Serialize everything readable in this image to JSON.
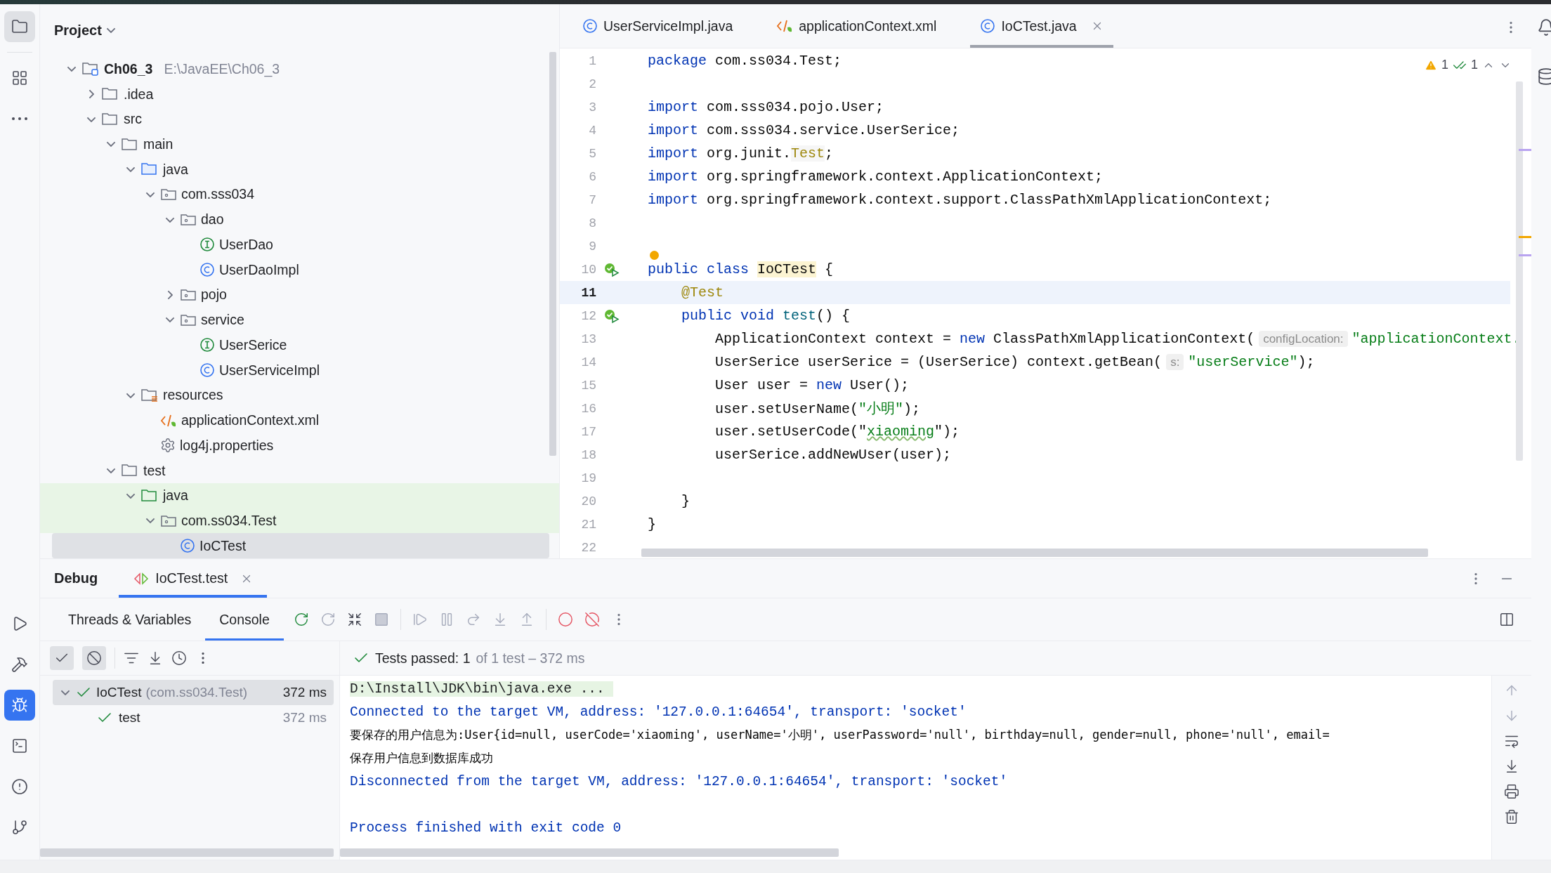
{
  "project": {
    "title": "Project",
    "tree": [
      {
        "name": "Ch06_3",
        "path": "E:\\JavaEE\\Ch06_3",
        "kind": "module",
        "expanded": true,
        "selected": false,
        "children": [
          {
            "name": ".idea",
            "kind": "folder",
            "expanded": false,
            "selected": false
          },
          {
            "name": "src",
            "kind": "folder",
            "expanded": true,
            "selected": false,
            "children": [
              {
                "name": "main",
                "kind": "folder",
                "expanded": true,
                "selected": false,
                "children": [
                  {
                    "name": "java",
                    "kind": "source_root",
                    "expanded": true,
                    "selected": false,
                    "children": [
                      {
                        "name": "com.sss034",
                        "kind": "package",
                        "expanded": true,
                        "selected": false,
                        "children": [
                          {
                            "name": "dao",
                            "kind": "package",
                            "expanded": true,
                            "selected": false,
                            "children": [
                              {
                                "name": "UserDao",
                                "kind": "interface",
                                "selected": false
                              },
                              {
                                "name": "UserDaoImpl",
                                "kind": "class",
                                "selected": false
                              }
                            ]
                          },
                          {
                            "name": "pojo",
                            "kind": "package",
                            "expanded": false,
                            "selected": false
                          },
                          {
                            "name": "service",
                            "kind": "package",
                            "expanded": true,
                            "selected": false,
                            "children": [
                              {
                                "name": "UserSerice",
                                "kind": "interface",
                                "selected": false
                              },
                              {
                                "name": "UserServiceImpl",
                                "kind": "class",
                                "selected": false
                              }
                            ]
                          }
                        ]
                      }
                    ]
                  },
                  {
                    "name": "resources",
                    "kind": "resources_root",
                    "expanded": true,
                    "selected": false,
                    "children": [
                      {
                        "name": "applicationContext.xml",
                        "kind": "xml",
                        "selected": false
                      },
                      {
                        "name": "log4j.properties",
                        "kind": "properties",
                        "selected": false
                      }
                    ]
                  }
                ]
              },
              {
                "name": "test",
                "kind": "folder",
                "expanded": true,
                "selected": false,
                "children": [
                  {
                    "name": "java",
                    "kind": "test_root",
                    "expanded": true,
                    "selected": false,
                    "children": [
                      {
                        "name": "com.ss034.Test",
                        "kind": "package",
                        "expanded": true,
                        "selected": false,
                        "children": [
                          {
                            "name": "IoCTest",
                            "kind": "class",
                            "selected": true
                          }
                        ]
                      }
                    ]
                  }
                ]
              }
            ]
          }
        ]
      }
    ]
  },
  "editor": {
    "tabs": [
      {
        "label": "UserServiceImpl.java",
        "kind": "class",
        "selected": false
      },
      {
        "label": "applicationContext.xml",
        "kind": "xml",
        "selected": false
      },
      {
        "label": "IoCTest.java",
        "kind": "class",
        "selected": true
      }
    ],
    "inspections": {
      "warnings": "1",
      "passed": "1"
    },
    "lines": [
      {
        "number": "1",
        "current": false,
        "tokens": [
          {
            "text": "package ",
            "kind": "keyword"
          },
          {
            "text": "com.ss034.Test;",
            "kind": "plain"
          }
        ]
      },
      {
        "number": "2",
        "current": false
      },
      {
        "number": "3",
        "current": false,
        "tokens": [
          {
            "text": "import ",
            "kind": "keyword"
          },
          {
            "text": "com.sss034.pojo.User;",
            "kind": "plain"
          }
        ]
      },
      {
        "number": "4",
        "current": false,
        "tokens": [
          {
            "text": "import ",
            "kind": "keyword"
          },
          {
            "text": "com.sss034.service.UserSerice;",
            "kind": "plain"
          }
        ]
      },
      {
        "number": "5",
        "current": false,
        "tokens": [
          {
            "text": "import ",
            "kind": "keyword"
          },
          {
            "text": "org.junit.",
            "kind": "plain"
          },
          {
            "text": "Test",
            "kind": "unused"
          },
          {
            "text": ";",
            "kind": "plain"
          }
        ]
      },
      {
        "number": "6",
        "current": false,
        "tokens": [
          {
            "text": "import ",
            "kind": "keyword"
          },
          {
            "text": "org.springframework.context.ApplicationContext;",
            "kind": "plain"
          }
        ]
      },
      {
        "number": "7",
        "current": false,
        "tokens": [
          {
            "text": "import ",
            "kind": "keyword"
          },
          {
            "text": "org.springframework.context.support.ClassPathXmlApplicationContext;",
            "kind": "plain"
          }
        ]
      },
      {
        "number": "8",
        "current": false
      },
      {
        "number": "9",
        "current": false
      },
      {
        "number": "10",
        "current": false,
        "run_icon": true,
        "tokens": [
          {
            "text": "public class ",
            "kind": "keyword"
          },
          {
            "text": "IoCTest",
            "kind": "highlight"
          },
          {
            "text": " {",
            "kind": "plain"
          }
        ]
      },
      {
        "number": "11",
        "current": true,
        "tokens": [
          {
            "text": "    @Test",
            "kind": "annotation"
          }
        ]
      },
      {
        "number": "12",
        "current": false,
        "run_icon": true,
        "tokens": [
          {
            "text": "    public void ",
            "kind": "keyword"
          },
          {
            "text": "test",
            "kind": "declaration"
          },
          {
            "text": "() {",
            "kind": "plain"
          }
        ]
      },
      {
        "number": "13",
        "current": false,
        "tokens": [
          {
            "text": "        ApplicationContext context = ",
            "kind": "plain"
          },
          {
            "text": "new",
            "kind": "keyword"
          },
          {
            "text": " ClassPathXmlApplicationContext(",
            "kind": "plain"
          },
          {
            "text": "configLocation:",
            "kind": "hint"
          },
          {
            "text": "\"applicationContext.",
            "kind": "string"
          }
        ]
      },
      {
        "number": "14",
        "current": false,
        "tokens": [
          {
            "text": "        UserSerice userSerice = (UserSerice) context.getBean(",
            "kind": "plain"
          },
          {
            "text": "s:",
            "kind": "hint"
          },
          {
            "text": "\"userService\"",
            "kind": "string"
          },
          {
            "text": ");",
            "kind": "plain"
          }
        ]
      },
      {
        "number": "15",
        "current": false,
        "tokens": [
          {
            "text": "        User user = ",
            "kind": "plain"
          },
          {
            "text": "new",
            "kind": "keyword"
          },
          {
            "text": " User();",
            "kind": "plain"
          }
        ]
      },
      {
        "number": "16",
        "current": false,
        "tokens": [
          {
            "text": "        user.setUserName(",
            "kind": "plain"
          },
          {
            "text": "\"小明\"",
            "kind": "string"
          },
          {
            "text": ");",
            "kind": "plain"
          }
        ]
      },
      {
        "number": "17",
        "current": false,
        "tokens": [
          {
            "text": "        user.setUserCode(\"",
            "kind": "plain"
          },
          {
            "text": "xiaoming",
            "kind": "typo"
          },
          {
            "text": "\");",
            "kind": "plain"
          }
        ]
      },
      {
        "number": "18",
        "current": false,
        "tokens": [
          {
            "text": "        userSerice.addNewUser(user);",
            "kind": "plain"
          }
        ]
      },
      {
        "number": "19",
        "current": false
      },
      {
        "number": "20",
        "current": false,
        "tokens": [
          {
            "text": "    }",
            "kind": "plain"
          }
        ]
      },
      {
        "number": "21",
        "current": false,
        "tokens": [
          {
            "text": "}",
            "kind": "plain"
          }
        ]
      },
      {
        "number": "22",
        "current": false
      }
    ]
  },
  "debug": {
    "title": "Debug",
    "tabs": [
      {
        "label": "IoCTest.test",
        "selected": true
      }
    ],
    "subtabs": [
      {
        "label": "Threads & Variables",
        "selected": false
      },
      {
        "label": "Console",
        "selected": true
      }
    ],
    "tests": [
      {
        "name": "IoCTest",
        "detail": "(com.ss034.Test)",
        "time": "372 ms",
        "passed": true,
        "expanded": true,
        "selected": true,
        "children": [
          {
            "name": "test",
            "time": "372 ms",
            "passed": true,
            "selected": false
          }
        ]
      }
    ],
    "status": {
      "passed": "Tests passed: 1",
      "detail": "of 1 test – 372 ms"
    },
    "console": [
      {
        "text": "D:\\Install\\JDK\\bin\\java.exe ...",
        "kind": "command"
      },
      {
        "text": "Connected to the target VM, address: '127.0.0.1:64654', transport: 'socket'",
        "kind": "system"
      },
      {
        "text": "要保存的用户信息为:User{id=null, userCode='xiaoming', userName='小明', userPassword='null', birthday=null, gender=null, phone='null', email=",
        "kind": "output"
      },
      {
        "text": "保存用户信息到数据库成功",
        "kind": "output"
      },
      {
        "text": "Disconnected from the target VM, address: '127.0.0.1:64654', transport: 'socket'",
        "kind": "system"
      },
      {
        "text": "Process finished with exit code 0",
        "kind": "exit"
      }
    ]
  }
}
